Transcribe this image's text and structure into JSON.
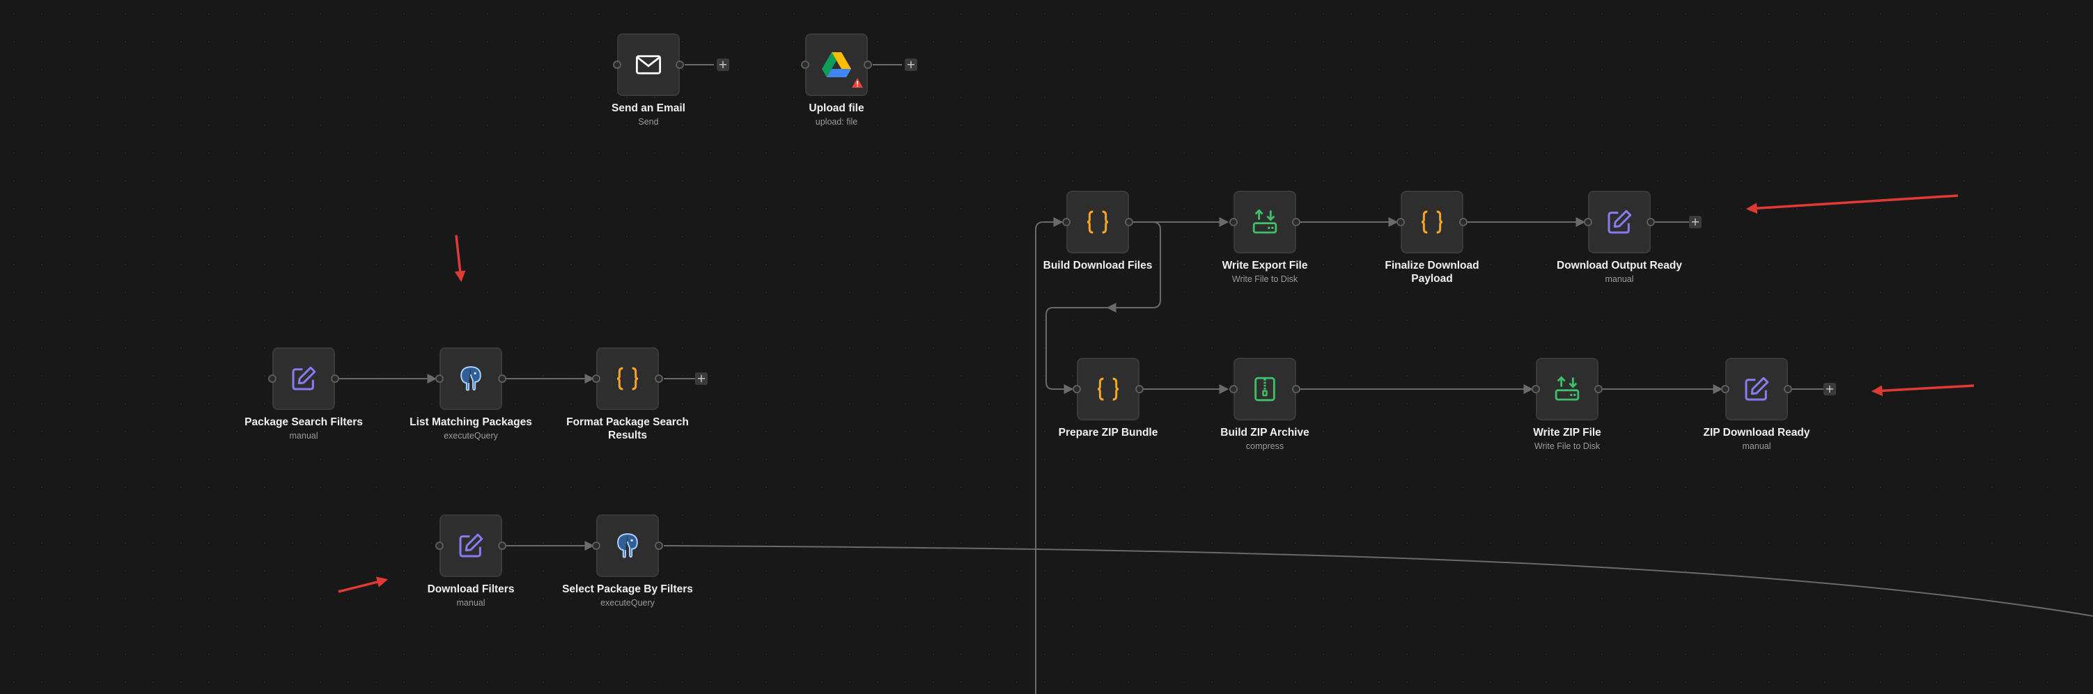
{
  "nodes": [
    {
      "id": "send-email",
      "label": "Send an Email",
      "sub": "Send",
      "icon": "envelope-icon"
    },
    {
      "id": "upload-file",
      "label": "Upload file",
      "sub": "upload: file",
      "icon": "google-drive-icon",
      "warning": "warning-icon"
    },
    {
      "id": "build-download-files",
      "label": "Build Download Files",
      "sub": "",
      "icon": "code-braces-icon"
    },
    {
      "id": "write-export-file",
      "label": "Write Export File",
      "sub": "Write File to Disk",
      "icon": "file-transfer-icon"
    },
    {
      "id": "finalize-download-payload",
      "label": "Finalize Download\nPayload",
      "sub": "",
      "icon": "code-braces-icon"
    },
    {
      "id": "download-output-ready",
      "label": "Download Output Ready",
      "sub": "manual",
      "icon": "edit-icon"
    },
    {
      "id": "prepare-zip-bundle",
      "label": "Prepare ZIP Bundle",
      "sub": "",
      "icon": "code-braces-icon"
    },
    {
      "id": "build-zip-archive",
      "label": "Build ZIP Archive",
      "sub": "compress",
      "icon": "zip-archive-icon"
    },
    {
      "id": "write-zip-file",
      "label": "Write ZIP File",
      "sub": "Write File to Disk",
      "icon": "file-transfer-icon"
    },
    {
      "id": "zip-download-ready",
      "label": "ZIP Download Ready",
      "sub": "manual",
      "icon": "edit-icon"
    },
    {
      "id": "package-search-filters",
      "label": "Package Search Filters",
      "sub": "manual",
      "icon": "edit-icon"
    },
    {
      "id": "list-matching-packages",
      "label": "List Matching Packages",
      "sub": "executeQuery",
      "icon": "postgres-elephant-icon"
    },
    {
      "id": "format-package-search-results",
      "label": "Format Package Search\nResults",
      "sub": "",
      "icon": "code-braces-icon"
    },
    {
      "id": "download-filters",
      "label": "Download Filters",
      "sub": "manual",
      "icon": "edit-icon"
    },
    {
      "id": "select-package-by-filters",
      "label": "Select Package By Filters",
      "sub": "executeQuery",
      "icon": "postgres-elephant-icon"
    }
  ],
  "add_button_label": "+",
  "colors": {
    "canvas_bg": "#181818",
    "node_bg": "#2e2e2e",
    "edge": "#6a6a6a",
    "code_icon": "#f5a623",
    "edit_icon": "#8a7cf0",
    "file_icon": "#3fbf6a",
    "postgres_icon": "#4a8fd8",
    "annotation_arrow": "#e03a35"
  }
}
